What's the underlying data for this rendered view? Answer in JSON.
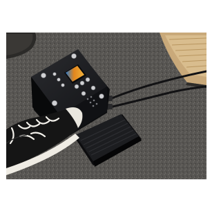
{
  "image": {
    "subject": "multi-effects-pedal-on-asphalt",
    "objects": [
      "sneaker",
      "effects-pedal",
      "expression-pedal",
      "guitar-cable",
      "amplifier",
      "guitar-body"
    ]
  },
  "colors": {
    "background": "#ffffff",
    "asphalt": "#5f5d59",
    "pedal_body": "#1b1c1f",
    "screen_orange": "#e2861d",
    "screen_blue": "#2b78c8",
    "amp_tolex": "#c9a97a"
  }
}
